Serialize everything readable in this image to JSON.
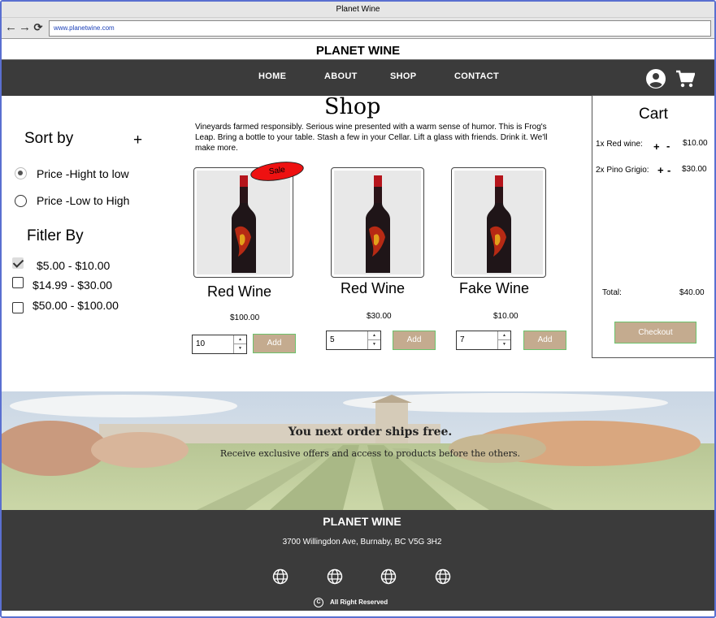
{
  "window": {
    "title": "Planet Wine",
    "url": "www.planetwine.com"
  },
  "brand": "PLANET WINE",
  "nav": {
    "home": "HOME",
    "about": "ABOUT",
    "shop": "SHOP",
    "contact": "CONTACT"
  },
  "sidebar": {
    "sort_title": "Sort by",
    "sort_toggle": "+",
    "sort_options": [
      "Price -Hight to low",
      "Price -Low to High"
    ],
    "sort_selected": "Price -Hight to low",
    "filter_title": "Fitler By",
    "filter_options": [
      "$5.00 - $10.00",
      "$14.99 - $30.00",
      "$50.00 - $100.00"
    ],
    "filter_checked": [
      "$5.00 - $10.00"
    ]
  },
  "shop": {
    "title": "Shop",
    "description": "Vineyards farmed responsibly. Serious wine presented with a warm sense of humor. This is Frog's Leap. Bring a bottle to your table. Stash a few in your Cellar. Lift a glass with friends. Drink it. We'll make more.",
    "sale_badge": "Sale",
    "products": [
      {
        "name": "Red Wine",
        "price": "$100.00",
        "qty": "10",
        "add": "Add"
      },
      {
        "name": "Red Wine",
        "price": "$30.00",
        "qty": "5",
        "add": "Add"
      },
      {
        "name": "Fake Wine",
        "price": "$10.00",
        "qty": "7",
        "add": "Add"
      }
    ]
  },
  "cart": {
    "title": "Cart",
    "items": [
      {
        "label": "1x Red wine:",
        "price": "$10.00"
      },
      {
        "label": "2x Pino Grigio:",
        "price": "$30.00"
      }
    ],
    "plus": "+",
    "minus": "-",
    "total_label": "Total:",
    "total_value": "$40.00",
    "checkout": "Checkout"
  },
  "banner": {
    "headline": "You next order ships free.",
    "subtext": "Receive exclusive offers and access to products before the others."
  },
  "footer": {
    "brand": "PLANET WINE",
    "address": "3700 Willingdon Ave, Burnaby, BC V5G 3H2",
    "copyright_symbol": "C",
    "copyright": "All Right Reserved",
    "social_icons": [
      "globe-icon",
      "globe-icon",
      "globe-icon",
      "globe-icon"
    ]
  },
  "colors": {
    "nav_bg": "#3b3b3b",
    "button": "#c4ab8f",
    "button_border": "#6cc26c",
    "sale": "#ee1111"
  }
}
